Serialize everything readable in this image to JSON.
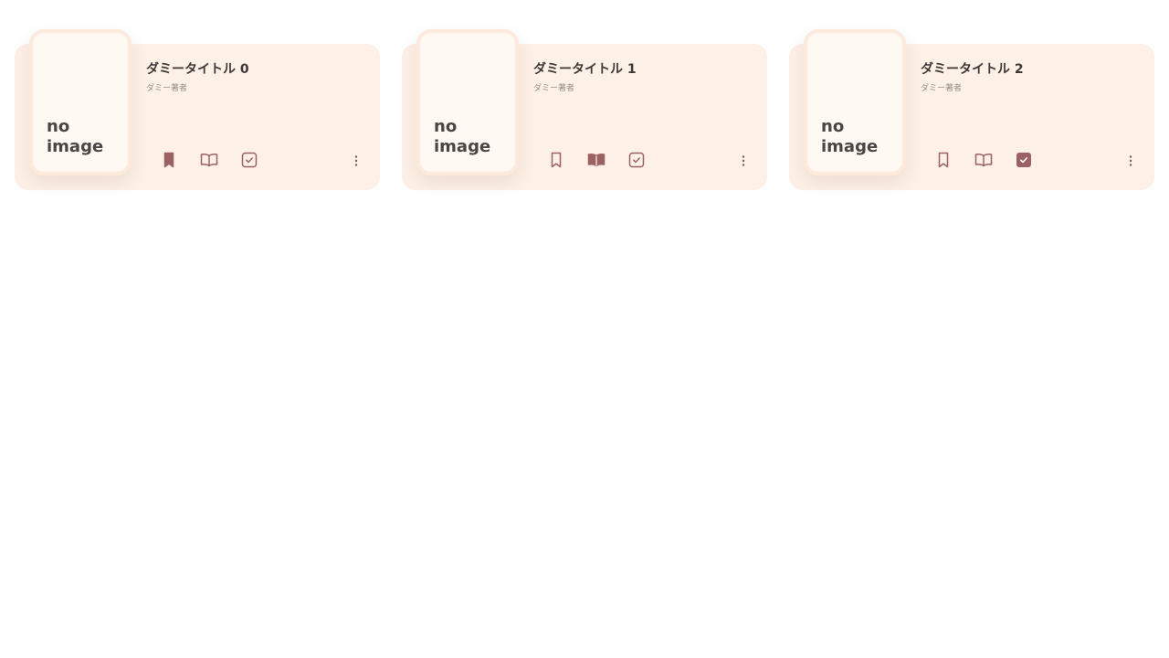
{
  "colors": {
    "card_bg": "#fdf0e6",
    "cover_bg": "#fff8f3",
    "accent": "#9c6263",
    "text_dark": "#3e3838",
    "text_muted": "#9a8c88"
  },
  "books": [
    {
      "cover_text": "no\nimage",
      "title": "ダミータイトル 0",
      "author": "ダミー著者",
      "bookmark_active": true,
      "reading_active": false,
      "done_active": false,
      "icons": [
        "bookmark-icon",
        "open-book-icon",
        "checkbox-icon",
        "more-vertical-icon"
      ]
    },
    {
      "cover_text": "no\nimage",
      "title": "ダミータイトル 1",
      "author": "ダミー著者",
      "bookmark_active": false,
      "reading_active": true,
      "done_active": false,
      "icons": [
        "bookmark-icon",
        "open-book-icon",
        "checkbox-icon",
        "more-vertical-icon"
      ]
    },
    {
      "cover_text": "no\nimage",
      "title": "ダミータイトル 2",
      "author": "ダミー著者",
      "bookmark_active": false,
      "reading_active": false,
      "done_active": true,
      "icons": [
        "bookmark-icon",
        "open-book-icon",
        "checkbox-icon",
        "more-vertical-icon"
      ]
    }
  ]
}
